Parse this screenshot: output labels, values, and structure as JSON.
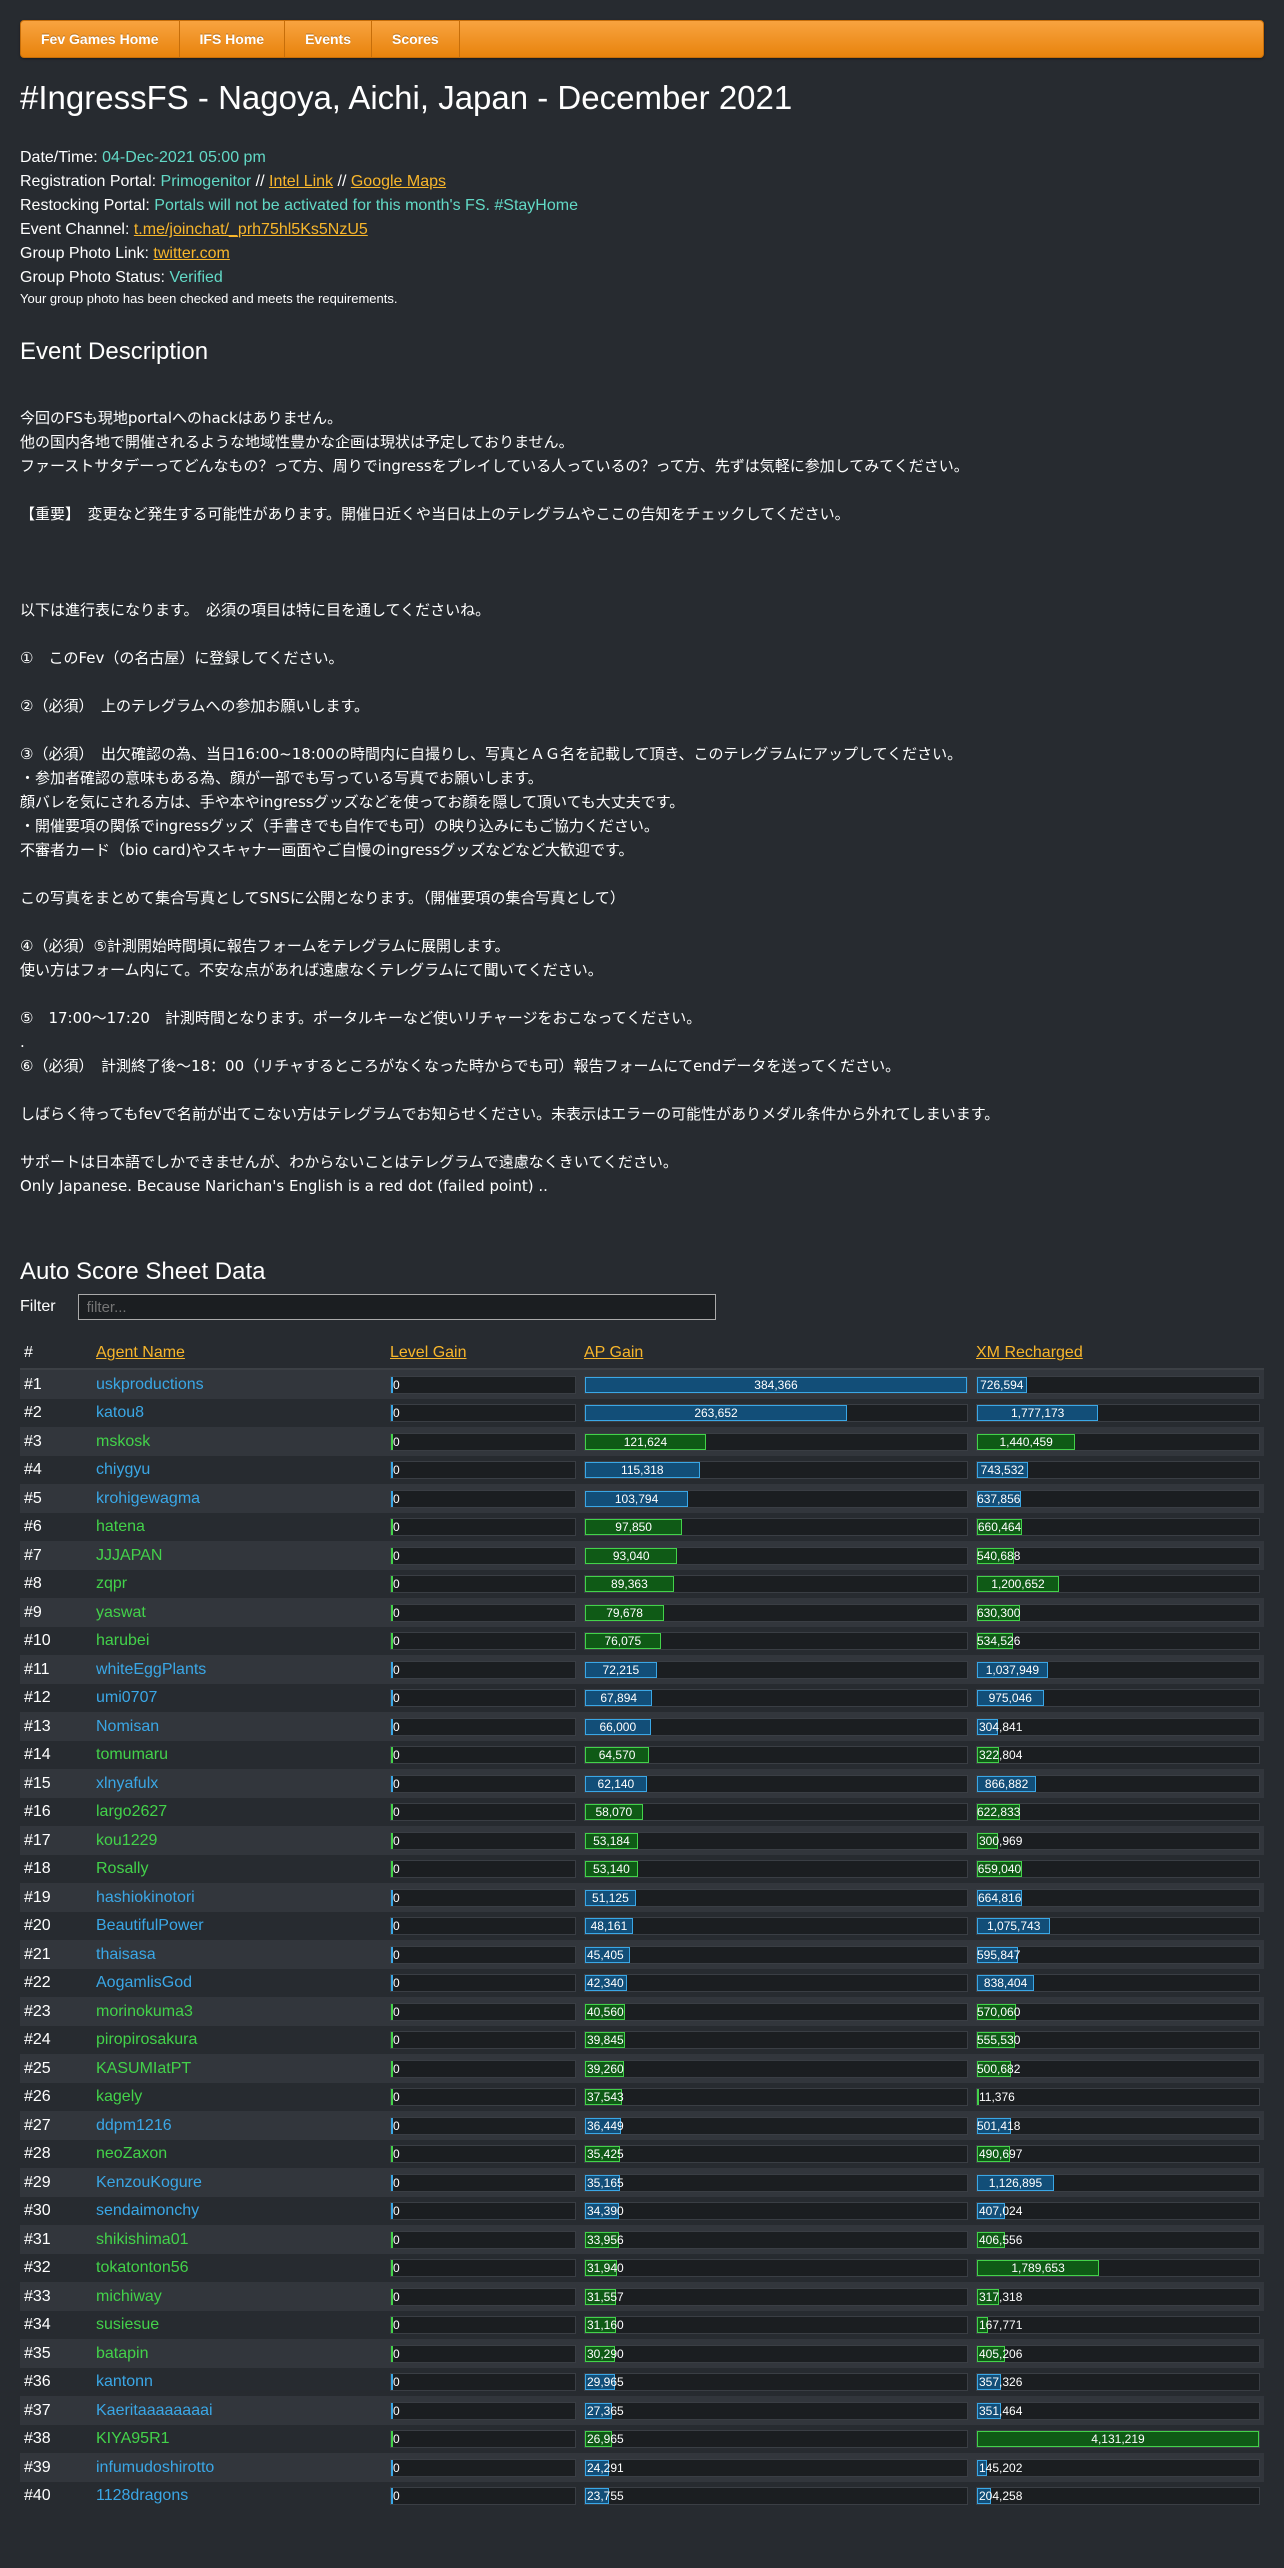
{
  "nav": [
    "Fev Games Home",
    "IFS Home",
    "Events",
    "Scores"
  ],
  "title": "#IngressFS - Nagoya, Aichi, Japan - December 2021",
  "info": {
    "datetime_label": "Date/Time:",
    "datetime": "04-Dec-2021 05:00 pm",
    "reg_label": "Registration Portal:",
    "reg_portal": "Primogenitor",
    "sep": "//",
    "intel_link": "Intel Link",
    "google_maps": "Google Maps",
    "restock_label": "Restocking Portal:",
    "restock": "Portals will not be activated for this month's FS. #StayHome",
    "channel_label": "Event Channel:",
    "channel": "t.me/joinchat/_prh75hl5Ks5NzU5",
    "photo_link_label": "Group Photo Link:",
    "photo_link": "twitter.com",
    "photo_status_label": "Group Photo Status:",
    "photo_status": "Verified",
    "photo_note": "Your group photo has been checked and meets the requirements."
  },
  "description_heading": "Event Description",
  "description": "今回のFSも現地portalへのhackはありません。\n他の国内各地で開催されるような地域性豊かな企画は現状は予定しておりません。\nファーストサタデーってどんなもの？って方、周りでingressをプレイしている人っているの？って方、先ずは気軽に参加してみてください。\n\n【重要】　変更など発生する可能性があります。開催日近くや当日は上のテレグラムやここの告知をチェックしてください。\n\n\n\n以下は進行表になります。　必須の項目は特に目を通してくださいね。\n\n①　このFev（の名古屋）に登録してください。\n\n②（必須）　上のテレグラムへの参加お願いします。\n\n③（必須）　出欠確認の為、当日16:00~18:00の時間内に自撮りし、写真とＡＧ名を記載して頂き、このテレグラムにアップしてください。\n・参加者確認の意味もある為、顔が一部でも写っている写真でお願いします。\n顔バレを気にされる方は、手や本やingressグッズなどを使ってお顔を隠して頂いても大丈夫です。\n・開催要項の関係でingressグッズ（手書きでも自作でも可）の映り込みにもご協力ください。\n不審者カード（bio card)やスキャナー画面やご自慢のingressグッズなどなど大歓迎です。\n\nこの写真をまとめて集合写真としてSNSに公開となります。（開催要項の集合写真として）\n\n④（必須）⑤計測開始時間頃に報告フォームをテレグラムに展開します。\n使い方はフォーム内にて。不安な点があれば遠慮なくテレグラムにて聞いてください。\n\n⑤　17:00～17:20　計測時間となります。ポータルキーなど使いリチャージをおこなってください。\n.\n⑥（必須）　計測終了後～18：00（リチャするところがなくなった時からでも可）報告フォームにてendデータを送ってください。\n\nしばらく待ってもfevで名前が出てこない方はテレグラムでお知らせください。未表示はエラーの可能性がありメダル条件から外れてしまいます。\n\nサポートは日本語でしかできませんが、わからないことはテレグラムで遠慮なくきいてください。\nOnly Japanese. Because Narichan's English is a red dot (failed point) ..",
  "sheet_heading": "Auto Score Sheet Data",
  "filter_label": "Filter",
  "filter_placeholder": "filter...",
  "columns": [
    "#",
    "Agent Name",
    "Level Gain",
    "AP Gain",
    "XM Recharged"
  ],
  "colors": {
    "res": "#3aa7e6",
    "enl": "#43d24a",
    "link": "#f8b62b",
    "teal": "#62d9c6"
  },
  "ap_max": 384366,
  "xm_max": 4131219,
  "rows": [
    {
      "rank": "#1",
      "name": "uskproductions",
      "faction": "res",
      "level": "0",
      "ap": 384366,
      "ap_label": "384,366",
      "xm": 726594,
      "xm_label": "726,594"
    },
    {
      "rank": "#2",
      "name": "katou8",
      "faction": "res",
      "level": "0",
      "ap": 263652,
      "ap_label": "263,652",
      "xm": 1777173,
      "xm_label": "1,777,173"
    },
    {
      "rank": "#3",
      "name": "mskosk",
      "faction": "enl",
      "level": "0",
      "ap": 121624,
      "ap_label": "121,624",
      "xm": 1440459,
      "xm_label": "1,440,459"
    },
    {
      "rank": "#4",
      "name": "chiygyu",
      "faction": "res",
      "level": "0",
      "ap": 115318,
      "ap_label": "115,318",
      "xm": 743532,
      "xm_label": "743,532"
    },
    {
      "rank": "#5",
      "name": "krohigewagma",
      "faction": "res",
      "level": "0",
      "ap": 103794,
      "ap_label": "103,794",
      "xm": 637856,
      "xm_label": "637,856"
    },
    {
      "rank": "#6",
      "name": "hatena",
      "faction": "enl",
      "level": "0",
      "ap": 97850,
      "ap_label": "97,850",
      "xm": 660464,
      "xm_label": "660,464"
    },
    {
      "rank": "#7",
      "name": "JJJAPAN",
      "faction": "enl",
      "level": "0",
      "ap": 93040,
      "ap_label": "93,040",
      "xm": 540688,
      "xm_label": "540,688"
    },
    {
      "rank": "#8",
      "name": "zqpr",
      "faction": "enl",
      "level": "0",
      "ap": 89363,
      "ap_label": "89,363",
      "xm": 1200652,
      "xm_label": "1,200,652"
    },
    {
      "rank": "#9",
      "name": "yaswat",
      "faction": "enl",
      "level": "0",
      "ap": 79678,
      "ap_label": "79,678",
      "xm": 630300,
      "xm_label": "630,300"
    },
    {
      "rank": "#10",
      "name": "harubei",
      "faction": "enl",
      "level": "0",
      "ap": 76075,
      "ap_label": "76,075",
      "xm": 534526,
      "xm_label": "534,526"
    },
    {
      "rank": "#11",
      "name": "whiteEggPlants",
      "faction": "res",
      "level": "0",
      "ap": 72215,
      "ap_label": "72,215",
      "xm": 1037949,
      "xm_label": "1,037,949"
    },
    {
      "rank": "#12",
      "name": "umi0707",
      "faction": "res",
      "level": "0",
      "ap": 67894,
      "ap_label": "67,894",
      "xm": 975046,
      "xm_label": "975,046"
    },
    {
      "rank": "#13",
      "name": "Nomisan",
      "faction": "res",
      "level": "0",
      "ap": 66000,
      "ap_label": "66,000",
      "xm": 304841,
      "xm_label": "304,841"
    },
    {
      "rank": "#14",
      "name": "tomumaru",
      "faction": "enl",
      "level": "0",
      "ap": 64570,
      "ap_label": "64,570",
      "xm": 322804,
      "xm_label": "322,804"
    },
    {
      "rank": "#15",
      "name": "xlnyafulx",
      "faction": "res",
      "level": "0",
      "ap": 62140,
      "ap_label": "62,140",
      "xm": 866882,
      "xm_label": "866,882"
    },
    {
      "rank": "#16",
      "name": "largo2627",
      "faction": "enl",
      "level": "0",
      "ap": 58070,
      "ap_label": "58,070",
      "xm": 622833,
      "xm_label": "622,833"
    },
    {
      "rank": "#17",
      "name": "kou1229",
      "faction": "enl",
      "level": "0",
      "ap": 53184,
      "ap_label": "53,184",
      "xm": 300969,
      "xm_label": "300,969"
    },
    {
      "rank": "#18",
      "name": "Rosally",
      "faction": "enl",
      "level": "0",
      "ap": 53140,
      "ap_label": "53,140",
      "xm": 659040,
      "xm_label": "659,040"
    },
    {
      "rank": "#19",
      "name": "hashiokinotori",
      "faction": "res",
      "level": "0",
      "ap": 51125,
      "ap_label": "51,125",
      "xm": 664816,
      "xm_label": "664,816"
    },
    {
      "rank": "#20",
      "name": "BeautifulPower",
      "faction": "res",
      "level": "0",
      "ap": 48161,
      "ap_label": "48,161",
      "xm": 1075743,
      "xm_label": "1,075,743"
    },
    {
      "rank": "#21",
      "name": "thaisasa",
      "faction": "res",
      "level": "0",
      "ap": 45405,
      "ap_label": "45,405",
      "xm": 595847,
      "xm_label": "595,847"
    },
    {
      "rank": "#22",
      "name": "AogamlisGod",
      "faction": "res",
      "level": "0",
      "ap": 42340,
      "ap_label": "42,340",
      "xm": 838404,
      "xm_label": "838,404"
    },
    {
      "rank": "#23",
      "name": "morinokuma3",
      "faction": "enl",
      "level": "0",
      "ap": 40560,
      "ap_label": "40,560",
      "xm": 570060,
      "xm_label": "570,060"
    },
    {
      "rank": "#24",
      "name": "piropirosakura",
      "faction": "enl",
      "level": "0",
      "ap": 39845,
      "ap_label": "39,845",
      "xm": 555530,
      "xm_label": "555,530"
    },
    {
      "rank": "#25",
      "name": "KASUMIatPT",
      "faction": "enl",
      "level": "0",
      "ap": 39260,
      "ap_label": "39,260",
      "xm": 500682,
      "xm_label": "500,682"
    },
    {
      "rank": "#26",
      "name": "kagely",
      "faction": "enl",
      "level": "0",
      "ap": 37543,
      "ap_label": "37,543",
      "xm": 11376,
      "xm_label": "11,376"
    },
    {
      "rank": "#27",
      "name": "ddpm1216",
      "faction": "res",
      "level": "0",
      "ap": 36449,
      "ap_label": "36,449",
      "xm": 501418,
      "xm_label": "501,418"
    },
    {
      "rank": "#28",
      "name": "neoZaxon",
      "faction": "enl",
      "level": "0",
      "ap": 35425,
      "ap_label": "35,425",
      "xm": 490697,
      "xm_label": "490,697"
    },
    {
      "rank": "#29",
      "name": "KenzouKogure",
      "faction": "res",
      "level": "0",
      "ap": 35165,
      "ap_label": "35,165",
      "xm": 1126895,
      "xm_label": "1,126,895"
    },
    {
      "rank": "#30",
      "name": "sendaimonchy",
      "faction": "res",
      "level": "0",
      "ap": 34390,
      "ap_label": "34,390",
      "xm": 407024,
      "xm_label": "407,024"
    },
    {
      "rank": "#31",
      "name": "shikishima01",
      "faction": "enl",
      "level": "0",
      "ap": 33956,
      "ap_label": "33,956",
      "xm": 406556,
      "xm_label": "406,556"
    },
    {
      "rank": "#32",
      "name": "tokatonton56",
      "faction": "enl",
      "level": "0",
      "ap": 31940,
      "ap_label": "31,940",
      "xm": 1789653,
      "xm_label": "1,789,653"
    },
    {
      "rank": "#33",
      "name": "michiway",
      "faction": "enl",
      "level": "0",
      "ap": 31557,
      "ap_label": "31,557",
      "xm": 317318,
      "xm_label": "317,318"
    },
    {
      "rank": "#34",
      "name": "susiesue",
      "faction": "enl",
      "level": "0",
      "ap": 31160,
      "ap_label": "31,160",
      "xm": 167771,
      "xm_label": "167,771"
    },
    {
      "rank": "#35",
      "name": "batapin",
      "faction": "enl",
      "level": "0",
      "ap": 30290,
      "ap_label": "30,290",
      "xm": 405206,
      "xm_label": "405,206"
    },
    {
      "rank": "#36",
      "name": "kantonn",
      "faction": "res",
      "level": "0",
      "ap": 29965,
      "ap_label": "29,965",
      "xm": 357326,
      "xm_label": "357,326"
    },
    {
      "rank": "#37",
      "name": "Kaeritaaaaaaaai",
      "faction": "res",
      "level": "0",
      "ap": 27365,
      "ap_label": "27,365",
      "xm": 351464,
      "xm_label": "351,464"
    },
    {
      "rank": "#38",
      "name": "KIYA95R1",
      "faction": "enl",
      "level": "0",
      "ap": 26965,
      "ap_label": "26,965",
      "xm": 4131219,
      "xm_label": "4,131,219"
    },
    {
      "rank": "#39",
      "name": "infumudoshirotto",
      "faction": "res",
      "level": "0",
      "ap": 24291,
      "ap_label": "24,291",
      "xm": 145202,
      "xm_label": "145,202"
    },
    {
      "rank": "#40",
      "name": "1128dragons",
      "faction": "res",
      "level": "0",
      "ap": 23755,
      "ap_label": "23,755",
      "xm": 204258,
      "xm_label": "204,258"
    }
  ]
}
